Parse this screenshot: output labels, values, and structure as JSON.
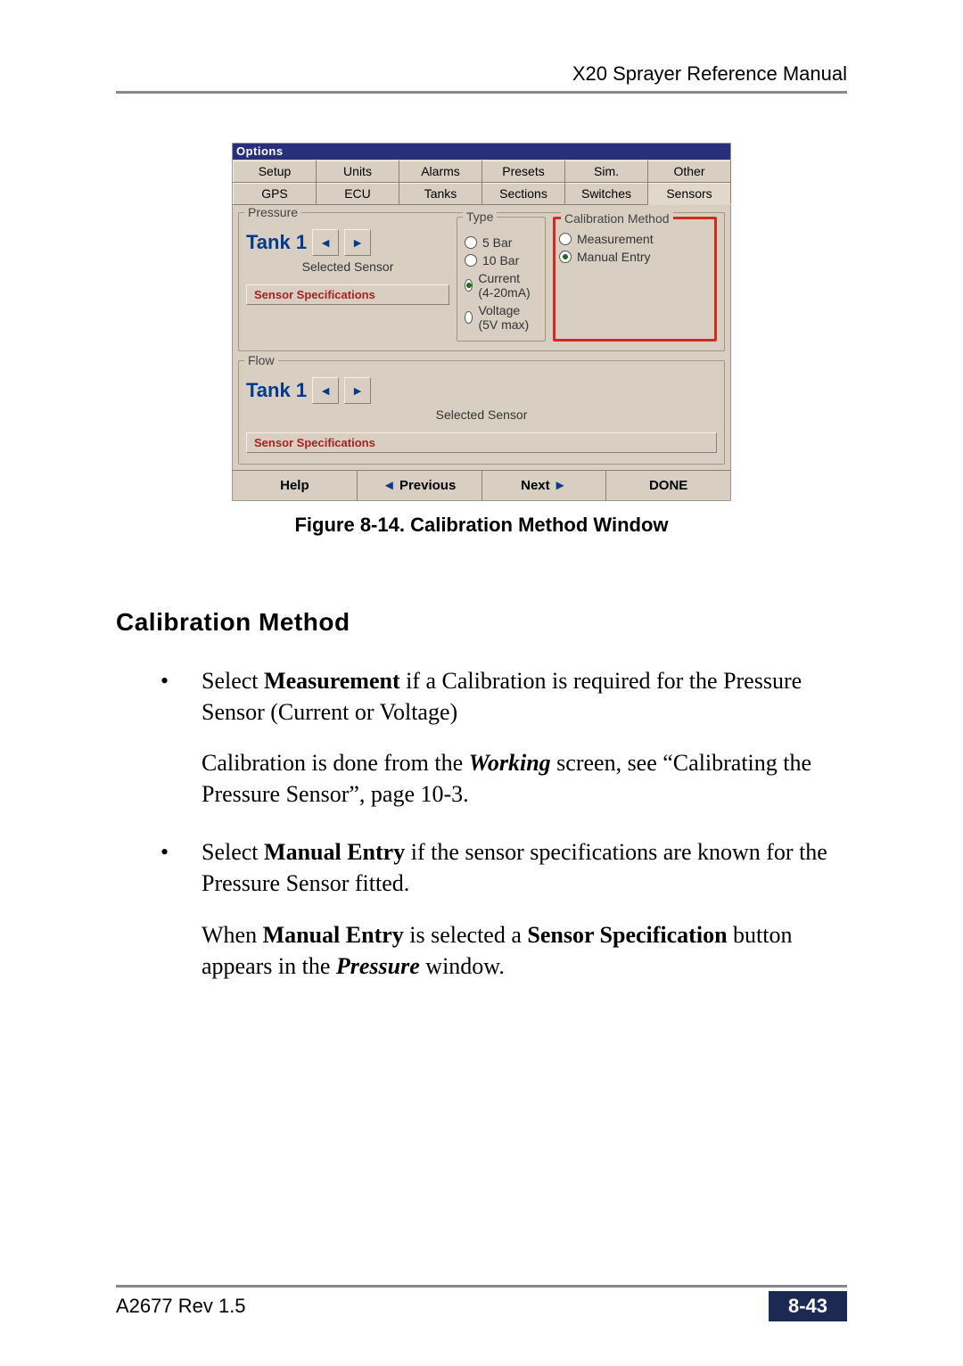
{
  "header": {
    "title": "X20 Sprayer Reference Manual"
  },
  "window": {
    "title": "Options",
    "tabs_row1": [
      "Setup",
      "Units",
      "Alarms",
      "Presets",
      "Sim.",
      "Other"
    ],
    "tabs_row2": [
      "GPS",
      "ECU",
      "Tanks",
      "Sections",
      "Switches",
      "Sensors"
    ],
    "active_tab": "Sensors",
    "pressure": {
      "legend": "Pressure",
      "tank_label": "Tank 1",
      "selected_sensor_label": "Selected Sensor",
      "spec_button": "Sensor Specifications"
    },
    "type_group": {
      "legend": "Type",
      "options": [
        "5 Bar",
        "10 Bar",
        "Current (4-20mA)",
        "Voltage (5V max)"
      ],
      "selected": "Current (4-20mA)"
    },
    "cal_group": {
      "legend": "Calibration Method",
      "options": [
        "Measurement",
        "Manual Entry"
      ],
      "selected": "Manual Entry"
    },
    "flow": {
      "legend": "Flow",
      "tank_label": "Tank 1",
      "selected_sensor_label": "Selected Sensor",
      "spec_button": "Sensor Specifications"
    },
    "bar": {
      "help": "Help",
      "prev": "Previous",
      "next": "Next",
      "done": "DONE"
    }
  },
  "caption": "Figure 8-14. Calibration Method Window",
  "section_heading": "Calibration Method",
  "list": {
    "item1_a": "Select ",
    "item1_b": "Measurement",
    "item1_c": " if a Calibration is required for the Pressure Sensor (Current or Voltage)",
    "item1_p2_a": "Calibration is done from the ",
    "item1_p2_b": "Working",
    "item1_p2_c": " screen, see “Calibrating the Pressure Sensor”, page 10-3.",
    "item2_a": "Select ",
    "item2_b": "Manual Entry",
    "item2_c": " if the sensor specifications are known for the Pressure Sensor fitted.",
    "item2_p2_a": "When ",
    "item2_p2_b": "Manual Entry",
    "item2_p2_c": " is selected a ",
    "item2_p2_d": "Sensor Specification",
    "item2_p2_e": " button appears in the ",
    "item2_p2_f": "Pressure",
    "item2_p2_g": " window."
  },
  "footer": {
    "left": "A2677 Rev 1.5",
    "page": "8-43"
  }
}
